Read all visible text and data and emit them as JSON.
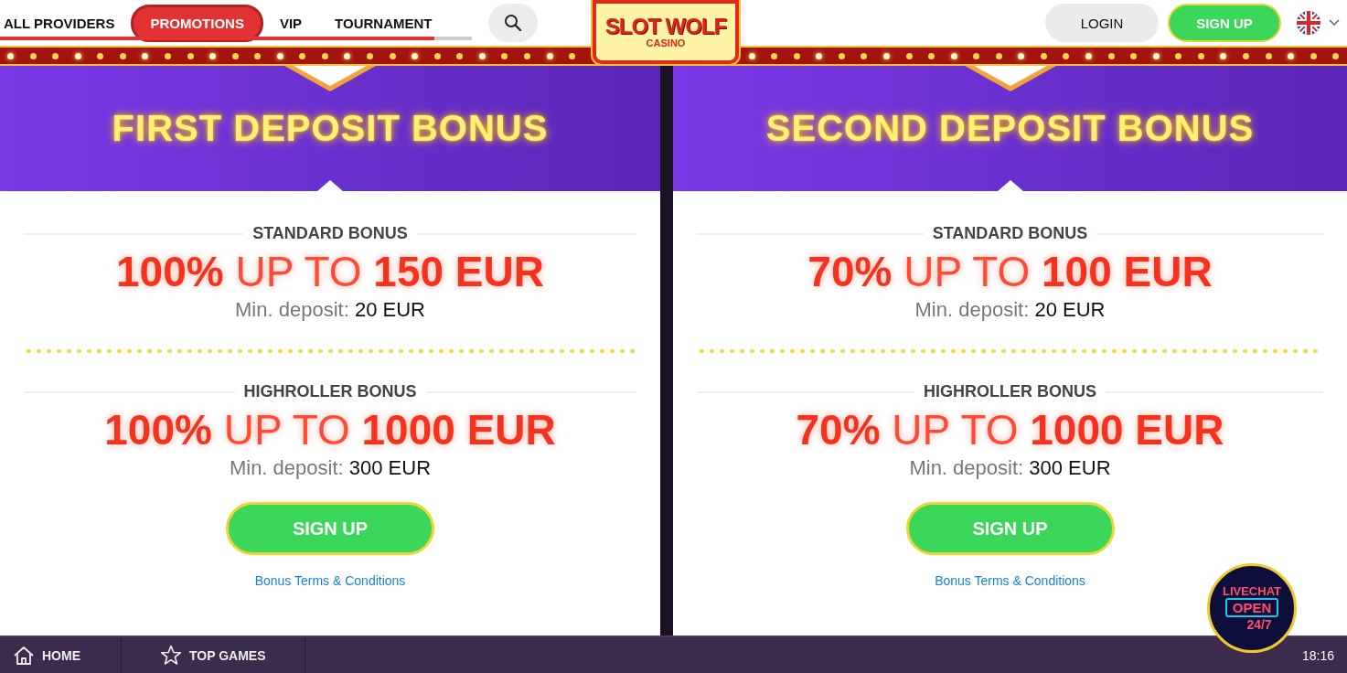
{
  "nav": {
    "tabs": [
      {
        "label": "ALL PROVIDERS",
        "selected": false
      },
      {
        "label": "PROMOTIONS",
        "selected": true
      },
      {
        "label": "VIP",
        "selected": false
      },
      {
        "label": "TOURNAMENT",
        "selected": false
      }
    ]
  },
  "logo": {
    "title": "SLOT WOLF",
    "subtitle": "CASINO"
  },
  "header_buttons": {
    "login": "LOGIN",
    "signup": "SIGN UP"
  },
  "bonuses": [
    {
      "title": "FIRST DEPOSIT BONUS",
      "tiers": [
        {
          "label": "STANDARD BONUS",
          "offer": "**100%** UP TO **150 EUR**",
          "min_label": "Min. deposit:",
          "min_value": "20 EUR"
        },
        {
          "label": "HIGHROLLER BONUS",
          "offer": "**100%** UP TO **1000 EUR**",
          "min_label": "Min. deposit:",
          "min_value": "300 EUR"
        }
      ],
      "button": "SIGN UP",
      "terms": "Bonus Terms & Conditions"
    },
    {
      "title": "SECOND DEPOSIT BONUS",
      "tiers": [
        {
          "label": "STANDARD BONUS",
          "offer": "**70%** UP TO **100 EUR**",
          "min_label": "Min. deposit:",
          "min_value": "20 EUR"
        },
        {
          "label": "HIGHROLLER BONUS",
          "offer": "**70%** UP TO **1000 EUR**",
          "min_label": "Min. deposit:",
          "min_value": "300 EUR"
        }
      ],
      "button": "SIGN UP",
      "terms": "Bonus Terms & Conditions"
    }
  ],
  "livechat": {
    "line1": "LIVECHAT",
    "line2": "OPEN",
    "line3": "24/7"
  },
  "bottom_bar": {
    "items": [
      {
        "label": "HOME",
        "kind": "home"
      },
      {
        "label": "TOP GAMES",
        "kind": "star"
      }
    ],
    "time": "18:16"
  }
}
